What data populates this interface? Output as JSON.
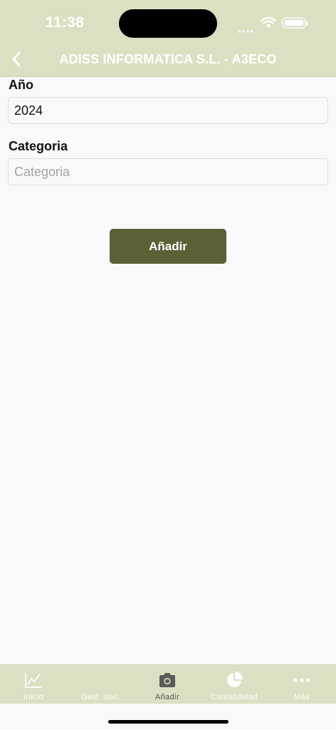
{
  "status_bar": {
    "time": "11:38"
  },
  "header": {
    "title": "ADISS INFORMATICA S.L. - A3ECO",
    "back_icon": "chevron-left-icon"
  },
  "form": {
    "year_label": "Año",
    "year_value": "2024",
    "category_label": "Categoria",
    "category_placeholder": "Categoria",
    "add_button": "Añadir"
  },
  "tabbar": {
    "tabs": [
      {
        "label": "Inicio",
        "icon": "chart-line-icon"
      },
      {
        "label": "Gest. doc.",
        "icon": "none"
      },
      {
        "label": "Añadir",
        "icon": "camera-icon",
        "active": true
      },
      {
        "label": "Contabilidad",
        "icon": "pie-chart-icon"
      },
      {
        "label": "Más",
        "icon": "more-dots-icon"
      }
    ]
  },
  "colors": {
    "header_bg": "#dcdfc1",
    "accent_button": "#5d5f37",
    "page_bg": "#f9f9f9"
  }
}
